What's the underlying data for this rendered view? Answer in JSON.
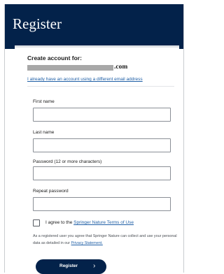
{
  "header": {
    "title": "Register"
  },
  "account": {
    "create_label": "Create account for:",
    "email_suffix": ".com",
    "alt_link": "I already have an account using a different email address"
  },
  "fields": {
    "first_name_label": "First name",
    "last_name_label": "Last name",
    "password_label": "Password (12 or more characters)",
    "repeat_password_label": "Repeat password"
  },
  "terms": {
    "prefix": "I agree to the ",
    "link": "Springer Nature Terms of Use",
    "checked": false
  },
  "consent": {
    "text": "As a registered user you agree that Springer Nature can collect and use your personal data as detailed in our ",
    "link": "Privacy Statement."
  },
  "register_button": {
    "label": "Register",
    "icon": "chevron-right-icon"
  },
  "colors": {
    "header_bg": "#03224a",
    "button_bg": "#03224a",
    "link": "#1f5fa6"
  }
}
